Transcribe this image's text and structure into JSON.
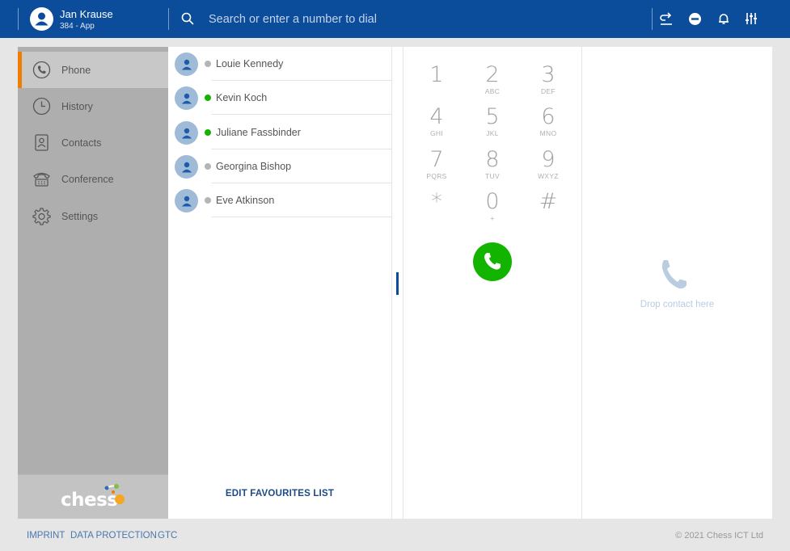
{
  "header": {
    "user_name": "Jan Krause",
    "user_ext": "384 - App",
    "search_placeholder": "Search or enter a number to dial",
    "icons": [
      "call-forward-icon",
      "do-not-disturb-icon",
      "bell-icon",
      "settings-sliders-icon"
    ]
  },
  "sidebar": {
    "items": [
      {
        "label": "Phone",
        "icon": "phone-icon",
        "active": true
      },
      {
        "label": "History",
        "icon": "clock-icon"
      },
      {
        "label": "Contacts",
        "icon": "contact-card-icon"
      },
      {
        "label": "Conference",
        "icon": "conference-phone-icon"
      },
      {
        "label": "Settings",
        "icon": "gear-icon"
      }
    ],
    "logo_text": "chess"
  },
  "favourites": {
    "contacts": [
      {
        "name": "Louie Kennedy",
        "status": "offline",
        "status_color": "#b5b5b5"
      },
      {
        "name": "Kevin Koch",
        "status": "online",
        "status_color": "#13b400"
      },
      {
        "name": "Juliane Fassbinder",
        "status": "online",
        "status_color": "#13b400"
      },
      {
        "name": "Georgina Bishop",
        "status": "offline",
        "status_color": "#b5b5b5"
      },
      {
        "name": "Eve Atkinson",
        "status": "offline",
        "status_color": "#b5b5b5"
      }
    ],
    "edit_label": "EDIT FAVOURITES LIST"
  },
  "dialpad": {
    "keys": [
      {
        "digit": "1",
        "letters": ""
      },
      {
        "digit": "2",
        "letters": "ABC"
      },
      {
        "digit": "3",
        "letters": "DEF"
      },
      {
        "digit": "4",
        "letters": "GHI"
      },
      {
        "digit": "5",
        "letters": "JKL"
      },
      {
        "digit": "6",
        "letters": "MNO"
      },
      {
        "digit": "7",
        "letters": "PQRS"
      },
      {
        "digit": "8",
        "letters": "TUV"
      },
      {
        "digit": "9",
        "letters": "WXYZ"
      },
      {
        "digit": "*",
        "letters": ""
      },
      {
        "digit": "0",
        "letters": "+"
      },
      {
        "digit": "#",
        "letters": ""
      }
    ],
    "call_color": "#13b400"
  },
  "dropzone": {
    "text": "Drop contact here"
  },
  "footer": {
    "links": [
      "IMPRINT",
      "DATA PROTECTION",
      "GTC"
    ],
    "copyright": "© 2021 Chess ICT Ltd"
  },
  "colors": {
    "brand_blue": "#0b4c9b",
    "accent_orange": "#f07d00"
  }
}
